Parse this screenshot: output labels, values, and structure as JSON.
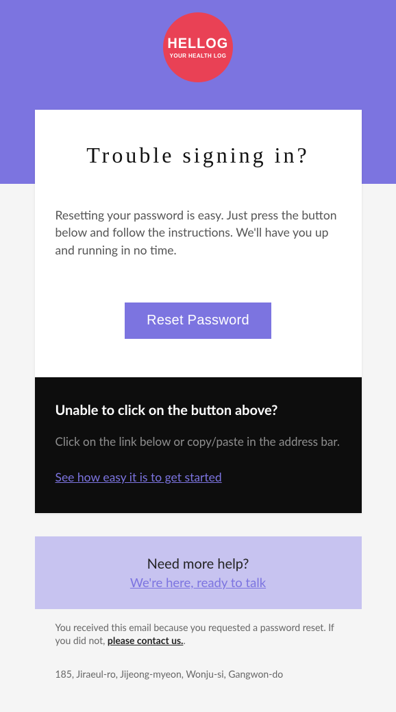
{
  "logo": {
    "title": "HELLOG",
    "subtitle": "YOUR HEALTH LOG"
  },
  "main": {
    "title": "Trouble signing in?",
    "text": "Resetting your password is easy. Just press the button below and follow the instructions. We'll have you up and running in no time.",
    "button_label": "Reset Password"
  },
  "dark": {
    "title": "Unable to click on the button above?",
    "text": "Click on the link below or copy/paste in the address bar.",
    "link_label": "See how easy it is to get started"
  },
  "help": {
    "title": "Need more help?",
    "link_label": "We're here, ready to talk"
  },
  "footer": {
    "text_before": "You received this email because you requested a password reset. If you did not, ",
    "contact_label": "please contact us.",
    "text_after": ".",
    "address": "185, Jiraeul-ro, Jijeong-myeon, Wonju-si, Gangwon-do"
  }
}
